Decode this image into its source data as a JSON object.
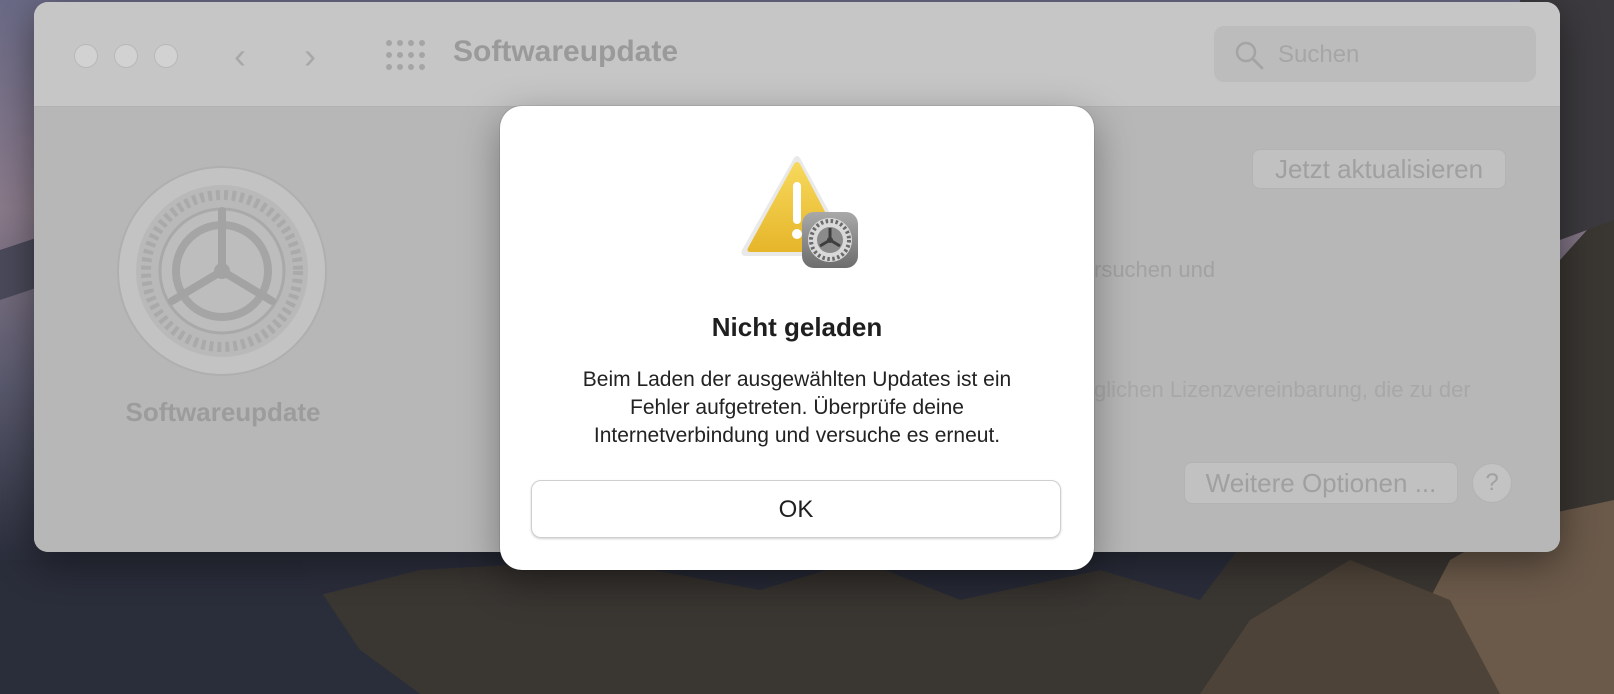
{
  "window": {
    "title": "Softwareupdate",
    "search": {
      "placeholder": "Suchen",
      "value": ""
    },
    "sidebar_label": "Softwareupdate",
    "update_button": "Jetzt aktualisieren",
    "partial_text_1": "rsuchen und",
    "partial_text_2": "glichen Lizenzvereinbarung, die zu der",
    "options_button": "Weitere Optionen ...",
    "help_button": "?"
  },
  "dialog": {
    "title": "Nicht geladen",
    "message_lines": [
      "Beim Laden der ausgewählten Updates ist ein",
      "Fehler aufgetreten. Überprüfe deine",
      "Internetverbindung und versuche es erneut."
    ],
    "ok_button": "OK"
  },
  "colors": {
    "warning_yellow": "#f2c53a",
    "dialog_bg": "#ffffff",
    "dimmed_window": "#b7b7b7"
  },
  "icons": [
    "close-icon",
    "minimize-icon",
    "zoom-icon",
    "back-icon",
    "forward-icon",
    "show-all-grid-icon",
    "search-icon",
    "gear-icon",
    "warning-icon"
  ]
}
